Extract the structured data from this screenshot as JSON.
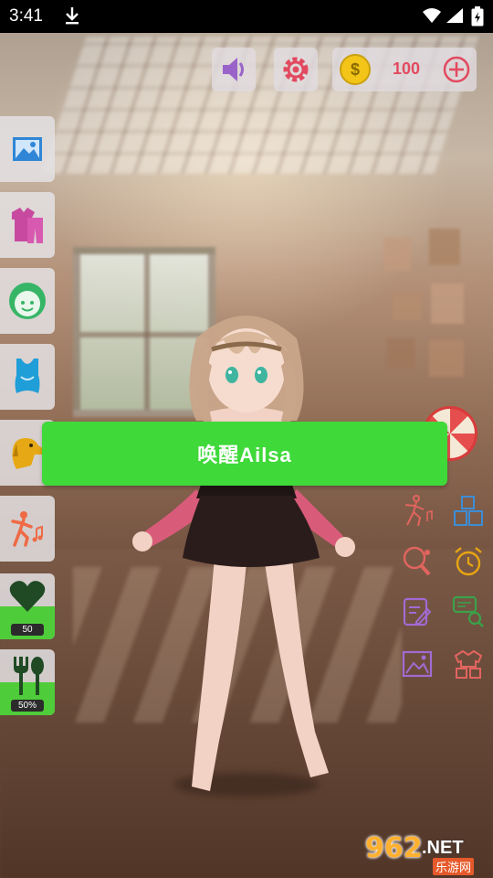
{
  "status_bar": {
    "time": "3:41"
  },
  "top_bar": {
    "coin_symbol": "$",
    "coin_amount": "100"
  },
  "left_menu": [
    {
      "name": "scene-image",
      "icon": "image-icon"
    },
    {
      "name": "clothes",
      "icon": "clothes-icon"
    },
    {
      "name": "face",
      "icon": "face-icon"
    },
    {
      "name": "swimsuit",
      "icon": "swimsuit-icon"
    },
    {
      "name": "pet",
      "icon": "dog-icon"
    },
    {
      "name": "dance",
      "icon": "dance-icon"
    }
  ],
  "stats": {
    "affection": {
      "icon": "heart-icon",
      "value": "50",
      "level": 0.5
    },
    "hunger": {
      "icon": "fork-spoon-icon",
      "value": "50%",
      "level": 0.5
    }
  },
  "right_tools": [
    "pose-icon",
    "blocks-icon",
    "ping-pong-icon",
    "alarm-clock-icon",
    "edit-icon",
    "chat-search-icon",
    "photo-icon",
    "wardrobe-icon"
  ],
  "main_button": {
    "label": "唤醒Ailsa"
  },
  "watermark": {
    "number": "962",
    "suffix": ".NET",
    "chinese": "乐游网"
  },
  "colors": {
    "accent_green": "#3fd93a",
    "icon_red": "#e24a5f",
    "coin_gold": "#f2c518"
  }
}
